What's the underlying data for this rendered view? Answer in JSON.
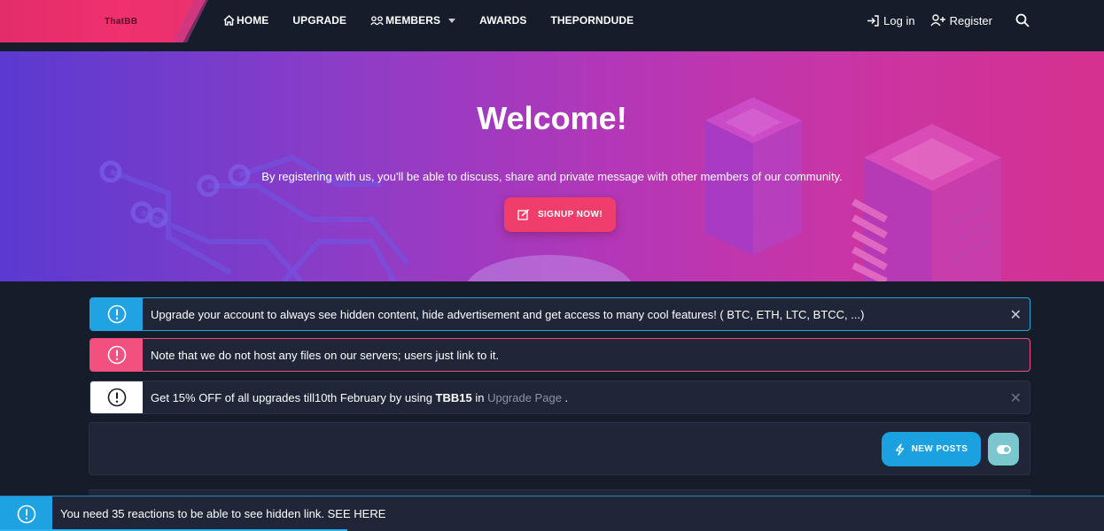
{
  "nav": {
    "logo_text": "ThatBB",
    "items": [
      {
        "label": "HOME",
        "icon": "home-icon"
      },
      {
        "label": "UPGRADE"
      },
      {
        "label": "MEMBERS",
        "icon": "members-icon"
      },
      {
        "label": "AWARDS"
      },
      {
        "label": "THEPORNDUDE"
      }
    ],
    "login_label": "Log in",
    "register_label": "Register"
  },
  "hero": {
    "title": "Welcome!",
    "subtitle": "By registering with us, you'll be able to discuss, share and private message with other members of our community.",
    "signup_label": "SIGNUP NOW!"
  },
  "notices": {
    "upgrade_text": "Upgrade your account to always see hidden content, hide advertisement and get access to many cool features! ( BTC, ETH, LTC, BTCC, ...)",
    "hosting_text": "Note that we do not host any files on our servers; users just link to it.",
    "promo_prefix": "Get 15% OFF of all upgrades till10th February by using ",
    "promo_code": "TBB15",
    "promo_mid": " in ",
    "promo_link": "Upgrade Page",
    "promo_suffix": " ."
  },
  "toolbar": {
    "new_posts_label": "NEW POSTS"
  },
  "bottom_notice": {
    "text": "You need 35 reactions to be able to see hidden link. SEE HERE"
  },
  "colors": {
    "bg": "#161d2a",
    "brand_pink": "#f03e6c",
    "info_blue": "#20a2e3"
  }
}
